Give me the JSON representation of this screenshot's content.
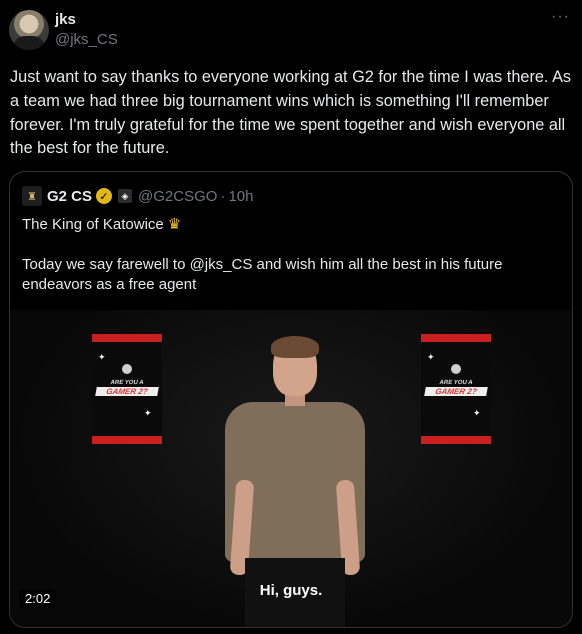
{
  "author": {
    "name": "jks",
    "handle": "@jks_CS",
    "more_icon": "···"
  },
  "tweet_text": "Just want to say thanks to everyone working at G2 for the time I was there. As a team we had three big tournament wins which is something I'll remember forever. I'm truly grateful for the time we spent together and wish everyone all the best for the future.",
  "quoted": {
    "name": "G2 CS",
    "handle": "@G2CSGO",
    "separator": "·",
    "time": "10h",
    "line1": "The King of Katowice",
    "crown_icon": "♛",
    "text": "Today we say farewell to @jks_CS and wish him all the best in his future endeavors as a free agent",
    "media": {
      "caption": "Hi, guys.",
      "duration": "2:02",
      "poster_line1": "ARE YOU A",
      "poster_line2": "GAMER 2?"
    }
  },
  "colors": {
    "background": "#000000",
    "text": "#e7e9ea",
    "muted": "#71767b",
    "border": "#2f3336",
    "verified_gold": "#e2b719",
    "poster_red": "#c8201f"
  }
}
